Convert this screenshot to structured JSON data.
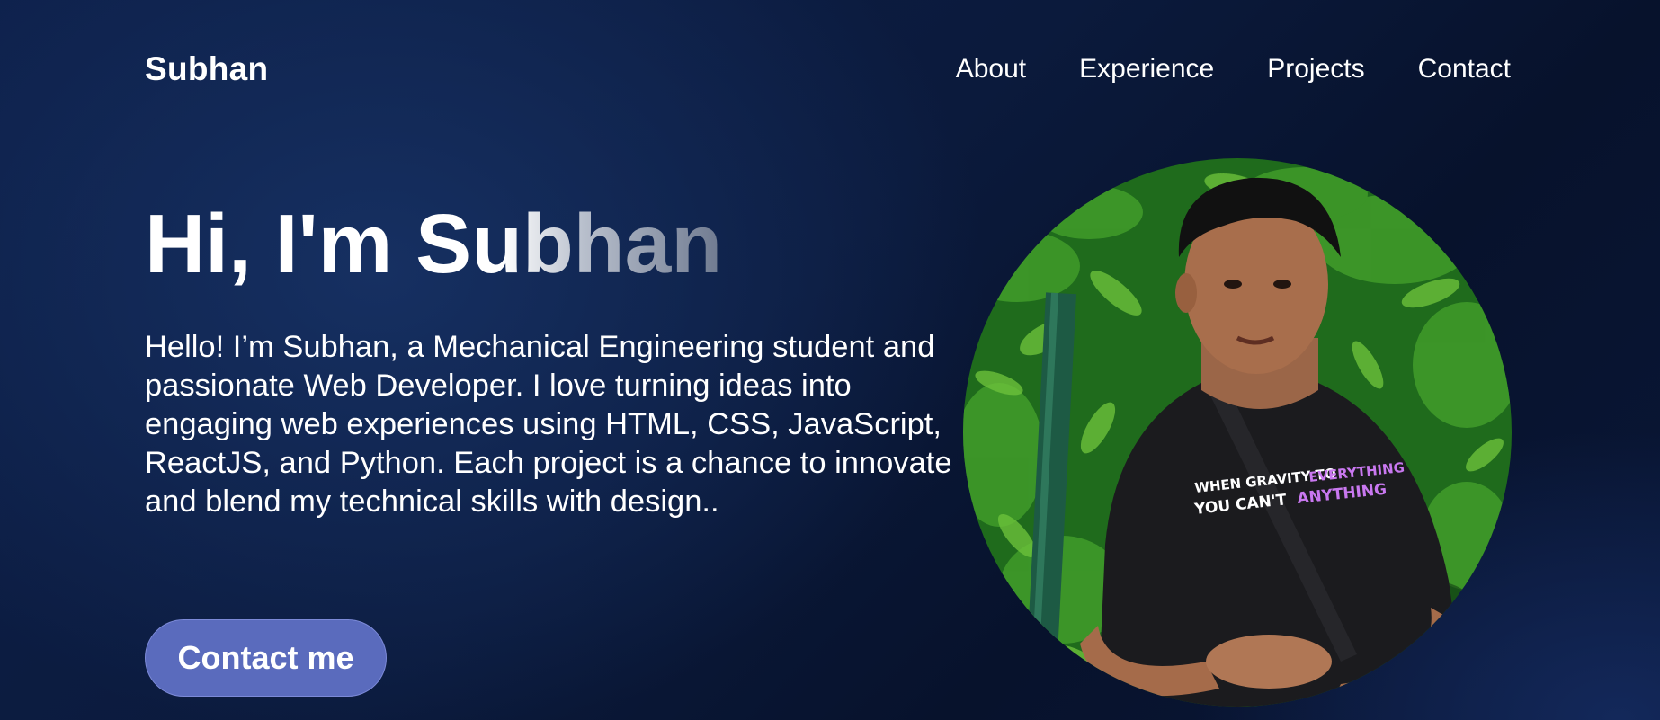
{
  "header": {
    "logo": "Subhan",
    "nav": [
      {
        "label": "About"
      },
      {
        "label": "Experience"
      },
      {
        "label": "Projects"
      },
      {
        "label": "Contact"
      }
    ]
  },
  "hero": {
    "title": "Hi, I'm Subhan",
    "description": "Hello! I’m Subhan, a Mechanical Engineering student and passionate Web Developer. I love turning ideas into engaging web experiences using HTML, CSS, JavaScript, ReactJS, and Python. Each project is a chance to innovate and blend my technical skills with design..",
    "cta_label": "Contact me"
  },
  "profile_photo": {
    "shirt_line1_white": "WHEN GRAVITY TO",
    "shirt_line1_pink": "EVERYTHING",
    "shirt_line2_white": "YOU CAN'T",
    "shirt_line2_pink": "ANYTHING"
  },
  "colors": {
    "background_dark": "#07122c",
    "background_mid": "#163062",
    "button_fill": "#5a6bbd",
    "text": "#ffffff"
  }
}
